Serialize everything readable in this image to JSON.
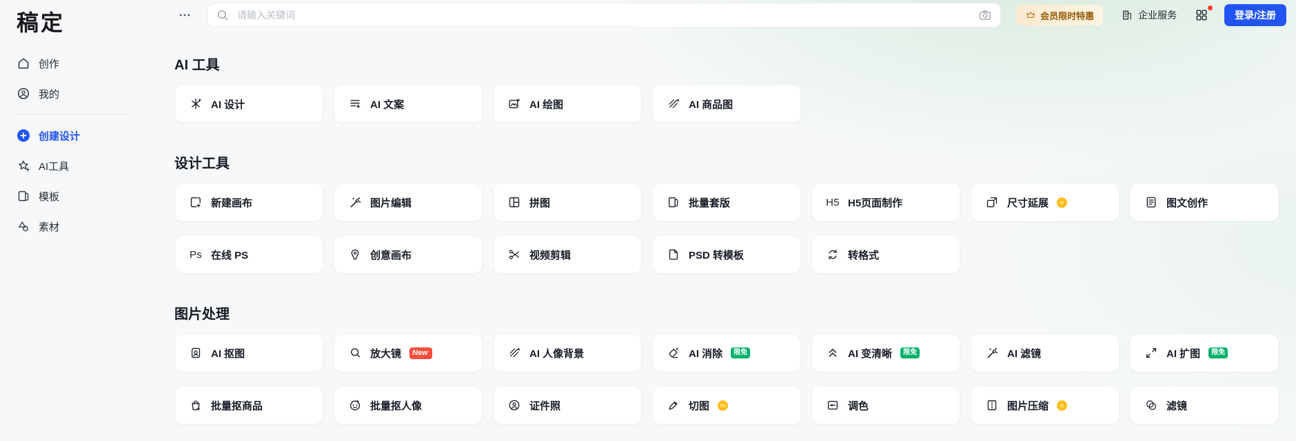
{
  "brand": {
    "logo_text": "稿定"
  },
  "colors": {
    "accent_blue": "#2254f4",
    "promo_text": "#935c08",
    "badge_new": "#fa4b3c",
    "badge_free": "#00b269",
    "badge_vip": "#ffbc12"
  },
  "sidebar": {
    "items": [
      {
        "label": "创作",
        "icon": "home-icon"
      },
      {
        "label": "我的",
        "icon": "user-icon"
      },
      {
        "type": "divider"
      },
      {
        "label": "创建设计",
        "icon": "plus-circle-icon",
        "active": true
      },
      {
        "label": "AI工具",
        "icon": "sparkle-star-icon"
      },
      {
        "label": "模板",
        "icon": "template-icon"
      },
      {
        "label": "素材",
        "icon": "shapes-icon"
      }
    ]
  },
  "topbar": {
    "more_icon": "more-icon",
    "search": {
      "placeholder": "请输入关键词",
      "icon": "search-icon",
      "camera_icon": "camera-icon"
    },
    "promo": {
      "label": "会员限时特惠",
      "icon": "crown-icon"
    },
    "enterprise": {
      "label": "企业服务",
      "icon": "building-icon"
    },
    "apps_icon": "grid-icon",
    "login": {
      "label": "登录/注册"
    }
  },
  "sections": [
    {
      "title": "AI 工具",
      "rows": [
        [
          {
            "label": "AI 设计",
            "icon": "sparkle-icon"
          },
          {
            "label": "AI 文案",
            "icon": "text-lines-icon"
          },
          {
            "label": "AI 绘图",
            "icon": "image-plus-icon"
          },
          {
            "label": "AI 商品图",
            "icon": "hatch-plus-icon"
          }
        ]
      ]
    },
    {
      "title": "设计工具",
      "rows": [
        [
          {
            "label": "新建画布",
            "icon": "canvas-plus-icon"
          },
          {
            "label": "图片编辑",
            "icon": "magic-wand-icon"
          },
          {
            "label": "拼图",
            "icon": "collage-icon"
          },
          {
            "label": "批量套版",
            "icon": "batch-pages-icon"
          },
          {
            "label": "H5页面制作",
            "icon": "h5-text-icon"
          },
          {
            "label": "尺寸延展",
            "icon": "resize-icon",
            "badge": {
              "type": "vip"
            }
          },
          {
            "label": "图文创作",
            "icon": "doc-text-icon"
          }
        ],
        [
          {
            "label": "在线 PS",
            "icon": "ps-text-icon"
          },
          {
            "label": "创意画布",
            "icon": "pen-nib-icon"
          },
          {
            "label": "视频剪辑",
            "icon": "scissors-icon"
          },
          {
            "label": "PSD 转模板",
            "icon": "file-icon"
          },
          {
            "label": "转格式",
            "icon": "convert-arrows-icon"
          }
        ]
      ]
    },
    {
      "title": "图片处理",
      "rows": [
        [
          {
            "label": "AI 抠图",
            "icon": "cutout-icon"
          },
          {
            "label": "放大镜",
            "icon": "magnifier-icon",
            "badge": {
              "type": "new",
              "label": "New"
            }
          },
          {
            "label": "AI 人像背景",
            "icon": "hatch-plus-icon"
          },
          {
            "label": "AI 消除",
            "icon": "eraser-icon",
            "badge": {
              "type": "free",
              "label": "限免"
            }
          },
          {
            "label": "AI 变清晰",
            "icon": "sharpen-chevrons-icon",
            "badge": {
              "type": "free",
              "label": "限免"
            }
          },
          {
            "label": "AI 滤镜",
            "icon": "magic-wand-icon"
          },
          {
            "label": "AI 扩图",
            "icon": "expand-icon",
            "badge": {
              "type": "free",
              "label": "限免"
            }
          }
        ],
        [
          {
            "label": "批量抠商品",
            "icon": "shopping-bag-icon"
          },
          {
            "label": "批量抠人像",
            "icon": "face-icon"
          },
          {
            "label": "证件照",
            "icon": "id-photo-icon"
          },
          {
            "label": "切图",
            "icon": "slice-pen-icon",
            "badge": {
              "type": "vip"
            }
          },
          {
            "label": "调色",
            "icon": "sliders-icon"
          },
          {
            "label": "图片压缩",
            "icon": "compress-icon",
            "badge": {
              "type": "vip"
            }
          },
          {
            "label": "滤镜",
            "icon": "filter-circles-icon"
          }
        ]
      ]
    }
  ]
}
